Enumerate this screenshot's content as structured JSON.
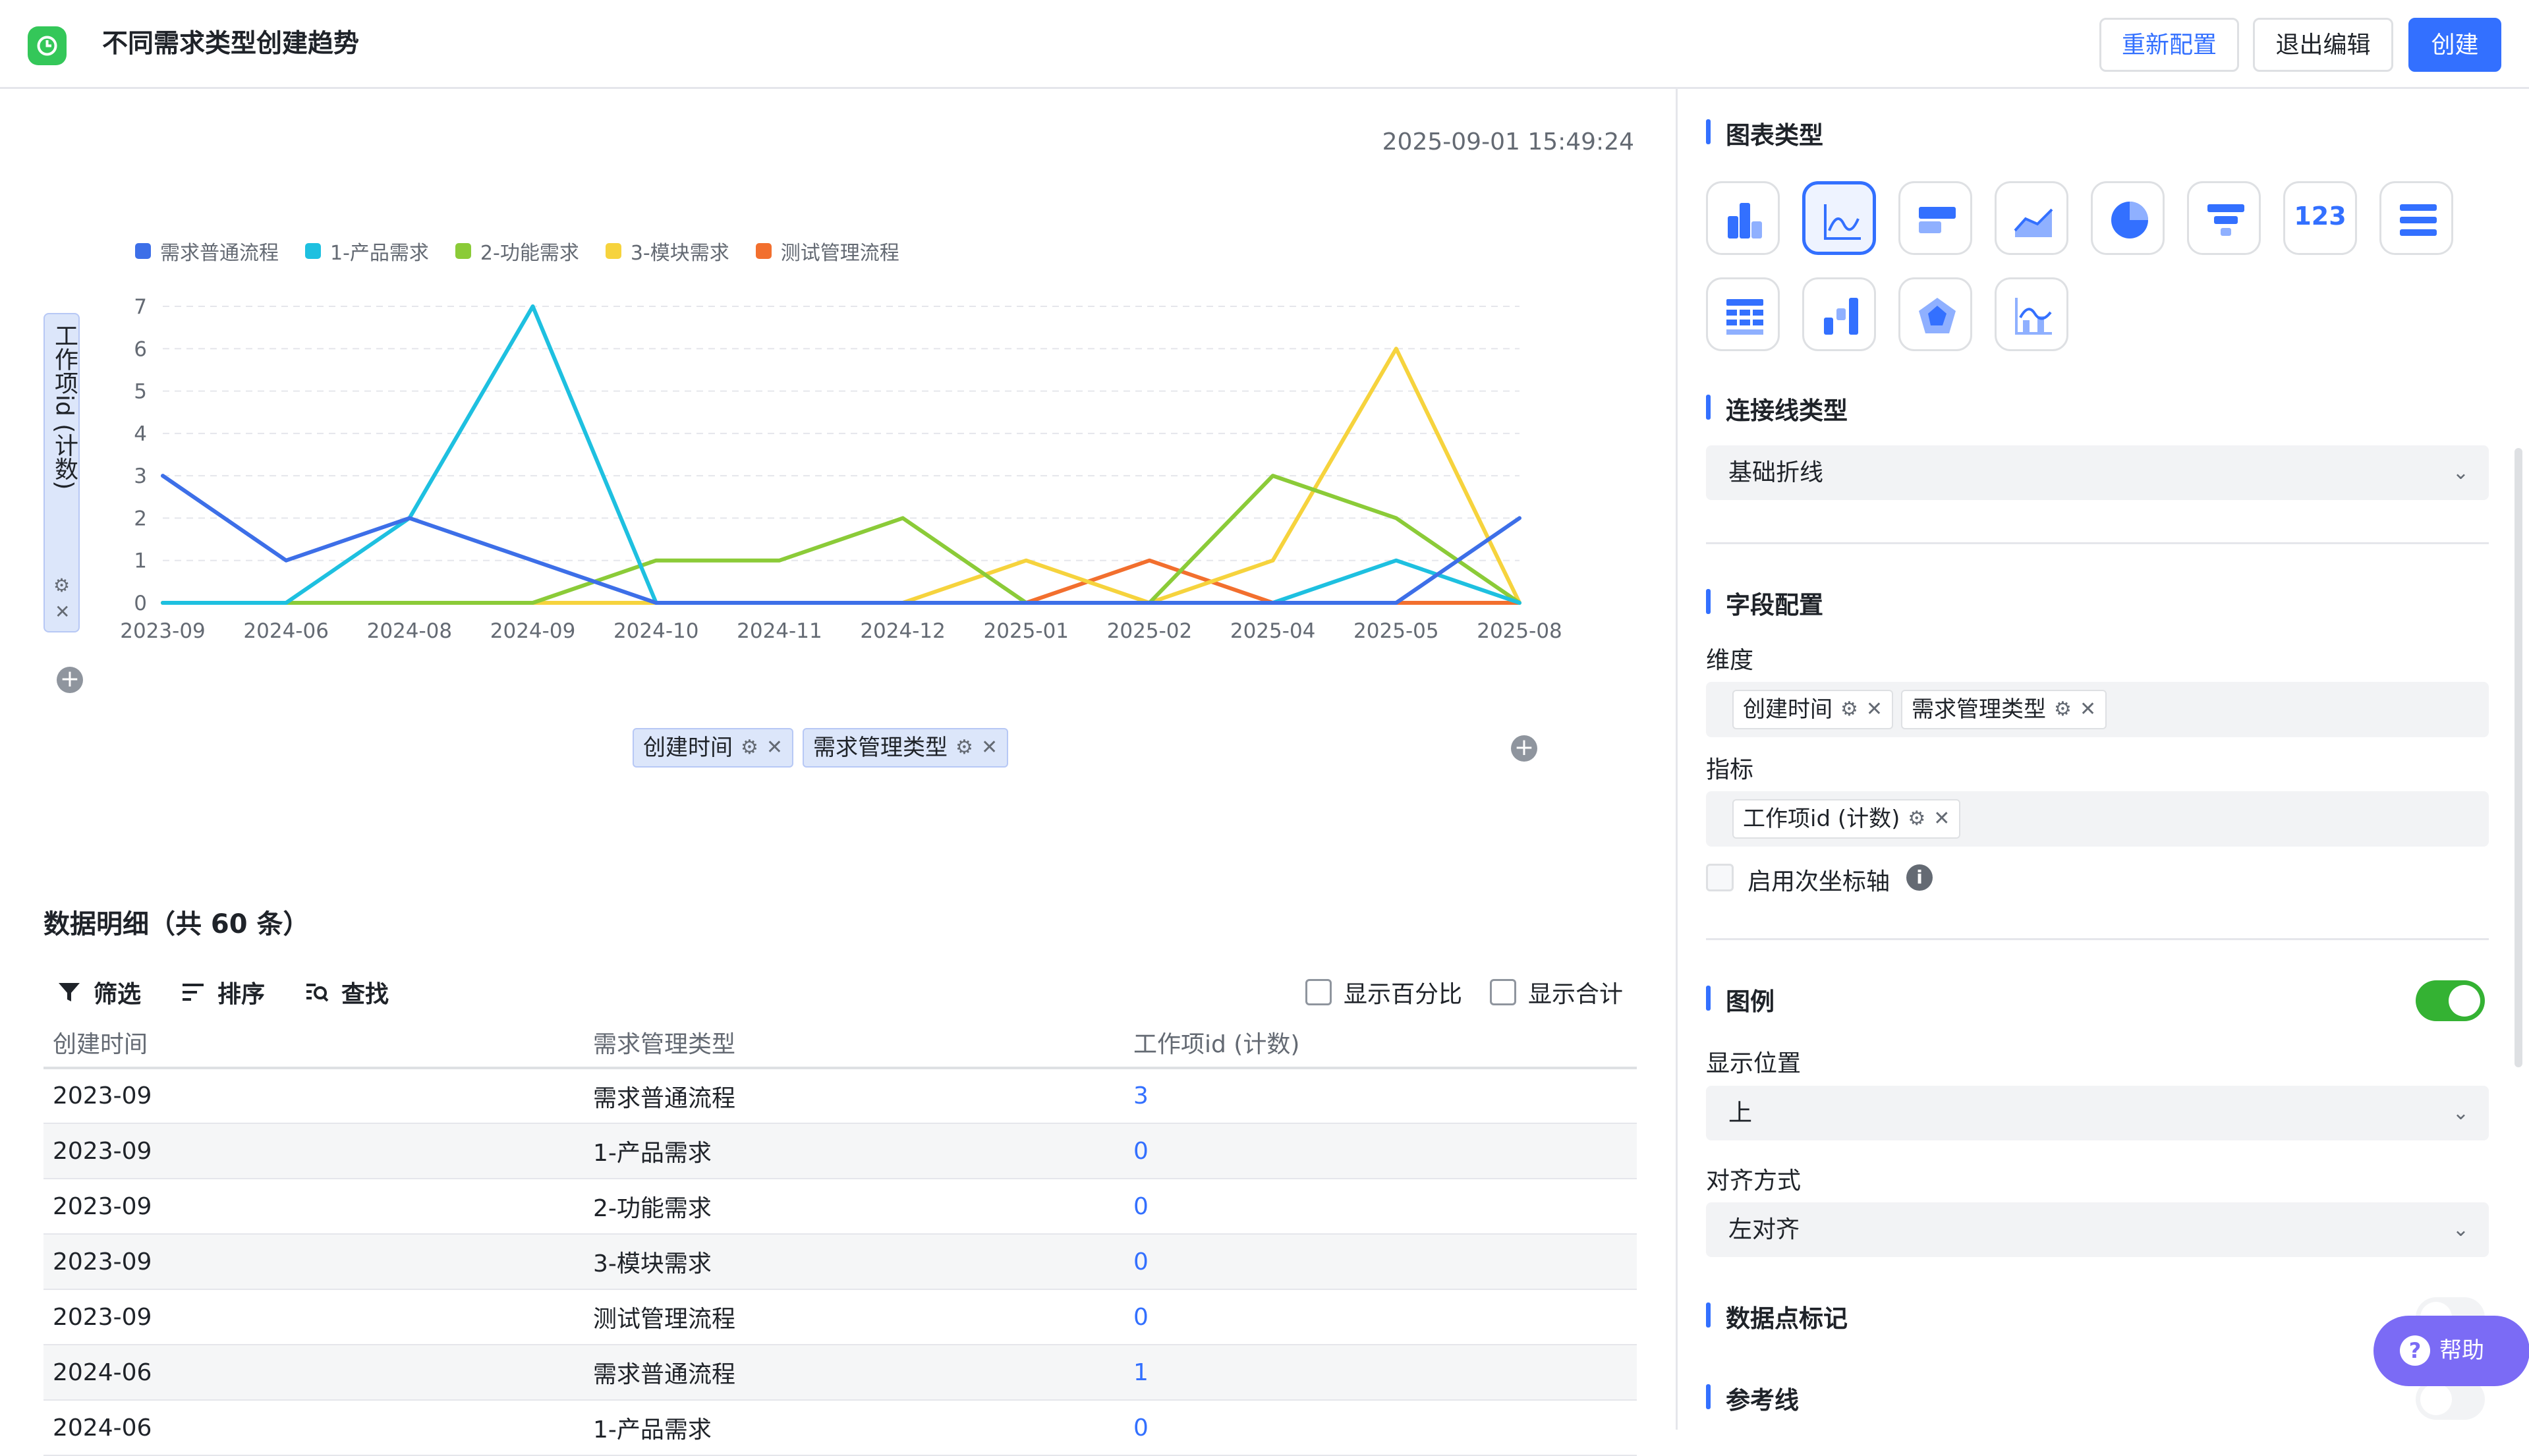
{
  "header": {
    "title": "不同需求类型创建趋势",
    "reconfigure": "重新配置",
    "exit_edit": "退出编辑",
    "create": "创建"
  },
  "chart_panel": {
    "timestamp": "2025-09-01 15:49:24",
    "y_field": "工作项id (计数)",
    "x_chips": [
      "创建时间",
      "需求管理类型"
    ]
  },
  "chart_data": {
    "type": "line",
    "categories": [
      "2023-09",
      "2024-06",
      "2024-08",
      "2024-09",
      "2024-10",
      "2024-11",
      "2024-12",
      "2025-01",
      "2025-02",
      "2025-04",
      "2025-05",
      "2025-08"
    ],
    "ylim": [
      0,
      7
    ],
    "yticks": [
      0,
      1,
      2,
      3,
      4,
      5,
      6,
      7
    ],
    "legend_position": "top-left",
    "grid": true,
    "series": [
      {
        "name": "需求普通流程",
        "color": "#3d6fe8",
        "values": [
          3,
          1,
          2,
          1,
          0,
          0,
          0,
          0,
          0,
          0,
          0,
          2
        ]
      },
      {
        "name": "1-产品需求",
        "color": "#1ec0e0",
        "values": [
          0,
          0,
          2,
          7,
          0,
          0,
          0,
          0,
          0,
          0,
          1,
          0
        ]
      },
      {
        "name": "2-功能需求",
        "color": "#8bcb38",
        "values": [
          0,
          0,
          0,
          0,
          1,
          1,
          2,
          0,
          0,
          3,
          2,
          0
        ]
      },
      {
        "name": "3-模块需求",
        "color": "#f6d33d",
        "values": [
          0,
          0,
          0,
          0,
          0,
          0,
          0,
          1,
          0,
          1,
          6,
          0
        ]
      },
      {
        "name": "测试管理流程",
        "color": "#f26f2e",
        "values": [
          0,
          0,
          0,
          0,
          0,
          0,
          0,
          0,
          1,
          0,
          0,
          0
        ]
      }
    ]
  },
  "detail": {
    "title": "数据明细（共 60 条）",
    "tools": [
      "筛选",
      "排序",
      "查找"
    ],
    "show_percent": "显示百分比",
    "show_total": "显示合计",
    "columns": [
      "创建时间",
      "需求管理类型",
      "工作项id (计数)"
    ],
    "rows": [
      [
        "2023-09",
        "需求普通流程",
        "3"
      ],
      [
        "2023-09",
        "1-产品需求",
        "0"
      ],
      [
        "2023-09",
        "2-功能需求",
        "0"
      ],
      [
        "2023-09",
        "3-模块需求",
        "0"
      ],
      [
        "2023-09",
        "测试管理流程",
        "0"
      ],
      [
        "2024-06",
        "需求普通流程",
        "1"
      ],
      [
        "2024-06",
        "1-产品需求",
        "0"
      ]
    ]
  },
  "settings": {
    "chart_type_title": "图表类型",
    "line_type_title": "连接线类型",
    "line_type_value": "基础折线",
    "field_config_title": "字段配置",
    "dimension_label": "维度",
    "dimension_chips": [
      "创建时间",
      "需求管理类型"
    ],
    "metric_label": "指标",
    "metric_chips": [
      "工作项id (计数)"
    ],
    "secondary_axis": "启用次坐标轴",
    "legend_title": "图例",
    "legend_enabled": true,
    "position_label": "显示位置",
    "position_value": "上",
    "align_label": "对齐方式",
    "align_value": "左对齐",
    "data_marker_title": "数据点标记",
    "ref_line_title": "参考线",
    "number_card_text": "123",
    "help": "帮助",
    "accent_color": "#3370ff",
    "toggle_on_color": "#34b233"
  }
}
